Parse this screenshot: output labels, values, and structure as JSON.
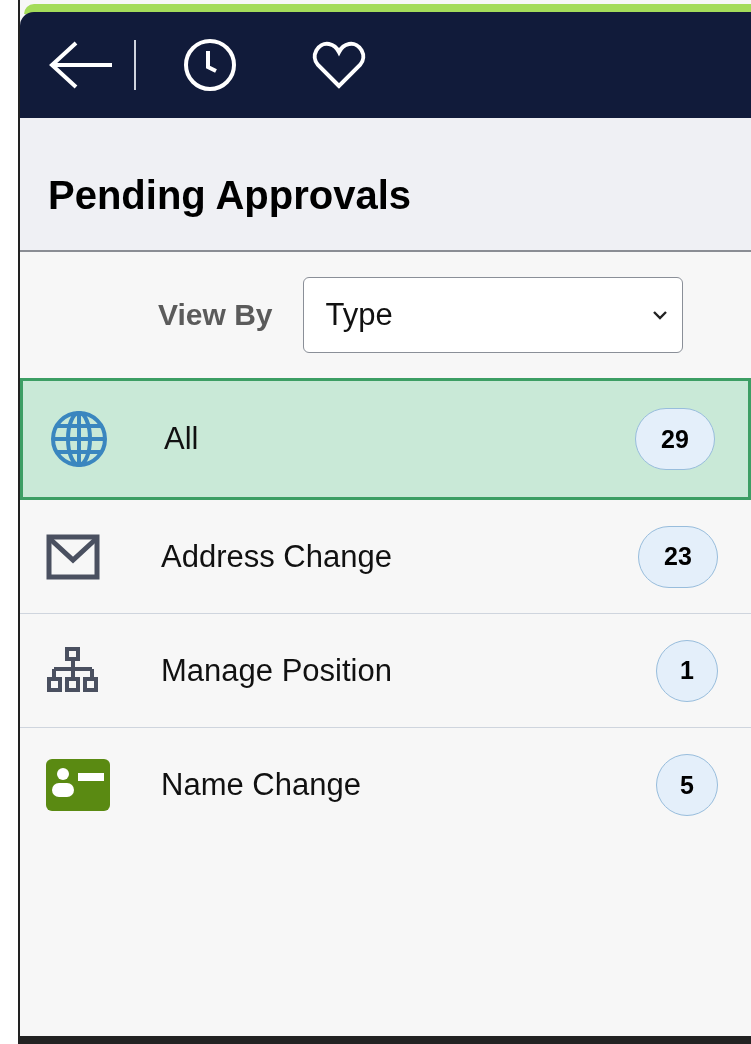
{
  "header": {
    "buttons": [
      {
        "kind": "back"
      },
      {
        "kind": "history"
      },
      {
        "kind": "favorite"
      }
    ]
  },
  "title": "Pending Approvals",
  "view_by": {
    "label": "View By",
    "value": "Type"
  },
  "items": [
    {
      "kind": "globe",
      "label": "All",
      "count": "29",
      "selected": true
    },
    {
      "kind": "mail",
      "label": "Address Change",
      "count": "23",
      "selected": false
    },
    {
      "kind": "org",
      "label": "Manage Position",
      "count": "1",
      "selected": false
    },
    {
      "kind": "card",
      "label": "Name Change",
      "count": "5",
      "selected": false
    }
  ]
}
